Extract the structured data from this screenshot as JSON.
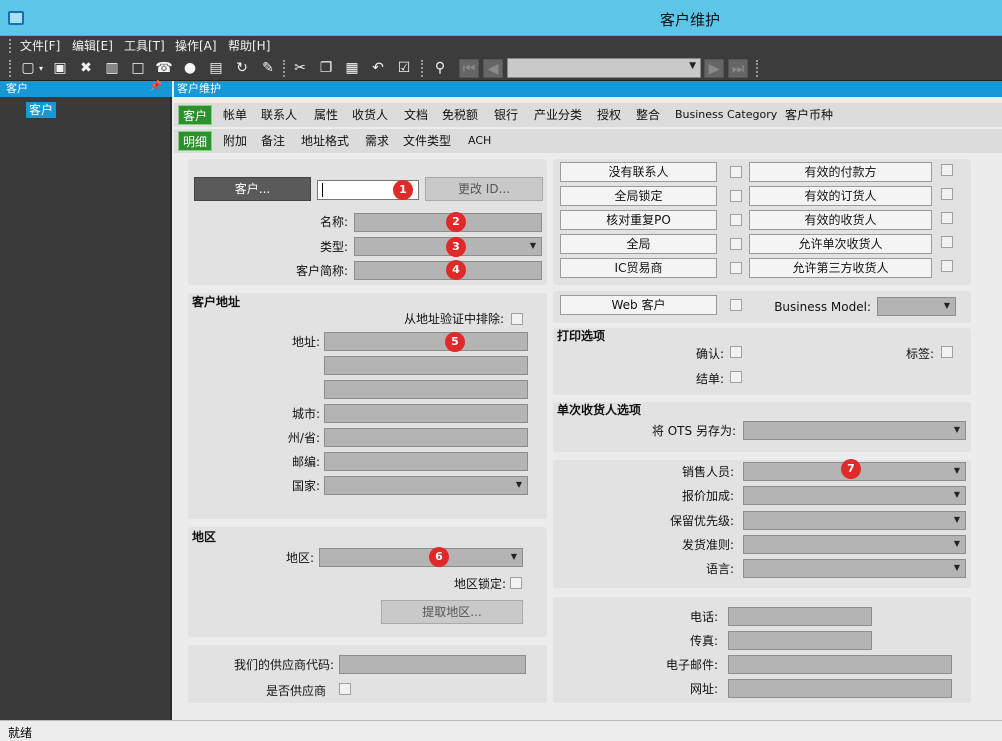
{
  "window": {
    "title": "客户维护"
  },
  "menu": [
    "文件[F]",
    "编辑[E]",
    "工具[T]",
    "操作[A]",
    "帮助[H]"
  ],
  "toolbar_icons": [
    "new-icon",
    "save-icon",
    "delete-icon",
    "book-icon",
    "note-icon",
    "phone-icon",
    "comment-icon",
    "clipboard-icon",
    "refresh-icon",
    "clear-icon",
    "cut-icon",
    "copy-icon",
    "paste-icon",
    "undo-icon",
    "checklist-icon",
    "binoculars-icon",
    "first-record-icon",
    "prev-record-icon",
    "next-record-icon",
    "last-record-icon"
  ],
  "left_panel": {
    "title": "客户",
    "tree_item": "客户"
  },
  "main_panel": {
    "title": "客户维护"
  },
  "tabs_row1": [
    "客户",
    "帐单",
    "联系人",
    "属性",
    "收货人",
    "文档",
    "免税额",
    "银行",
    "产业分类",
    "授权",
    "整合",
    "Business Category",
    "客户币种"
  ],
  "tabs_row2": [
    "明细",
    "附加",
    "备注",
    "地址格式",
    "需求",
    "文件类型",
    "ACH"
  ],
  "customer_section": {
    "customer_button": "客户...",
    "customer_id_value": "",
    "change_id_button": "更改 ID...",
    "name_label": "名称:",
    "type_label": "类型:",
    "short_name_label": "客户简称:"
  },
  "address_section": {
    "title": "客户地址",
    "exclude_label": "从地址验证中排除:",
    "address_label": "地址:",
    "city_label": "城市:",
    "state_label": "州/省:",
    "zip_label": "邮编:",
    "country_label": "国家:"
  },
  "region_section": {
    "title": "地区",
    "region_label": "地区:",
    "region_lock_label": "地区锁定:",
    "fetch_button": "提取地区..."
  },
  "vendor_section": {
    "vendor_code_label": "我们的供应商代码:",
    "is_vendor_label": "是否供应商"
  },
  "flags_left": [
    "没有联系人",
    "全局锁定",
    "核对重复PO",
    "全局",
    "IC贸易商"
  ],
  "flags_right": [
    "有效的付款方",
    "有效的订货人",
    "有效的收货人",
    "允许单次收货人",
    "允许第三方收货人"
  ],
  "web": {
    "web_customer_button": "Web 客户",
    "business_model_label": "Business Model:"
  },
  "print_section": {
    "title": "打印选项",
    "confirm_label": "确认:",
    "tag_label": "标签:",
    "statement_label": "结单:"
  },
  "ots_section": {
    "title": "单次收货人选项",
    "save_as_label": "将 OTS 另存为:"
  },
  "sales_section": {
    "sales_rep_label": "销售人员:",
    "quote_markup_label": "报价加成:",
    "reserve_priority_label": "保留优先级:",
    "shipping_rule_label": "发货准则:",
    "language_label": "语言:"
  },
  "contact_section": {
    "phone_label": "电话:",
    "fax_label": "传真:",
    "email_label": "电子邮件:",
    "web_label": "网址:"
  },
  "badges": [
    "1",
    "2",
    "3",
    "4",
    "5",
    "6",
    "7"
  ],
  "status": {
    "text": "就绪"
  }
}
